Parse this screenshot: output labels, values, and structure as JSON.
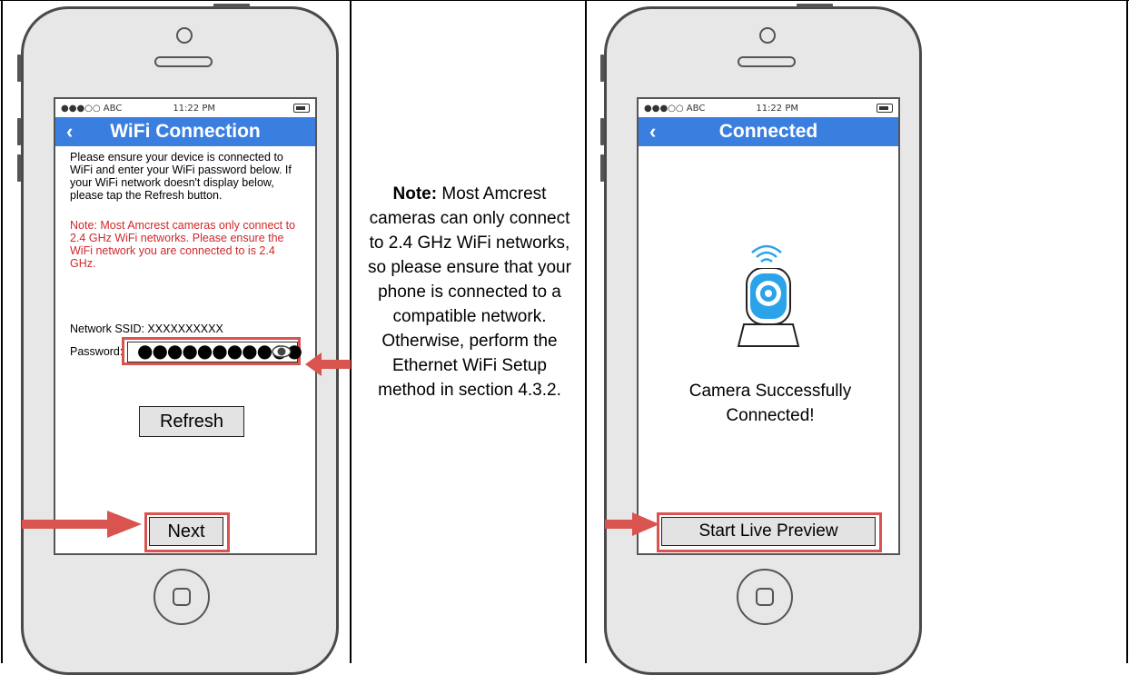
{
  "left_phone": {
    "status": {
      "carrier": "●●●○○ ABC",
      "time": "11:22 PM"
    },
    "nav": {
      "back": "‹",
      "title": "WiFi Connection"
    },
    "instructions": "Please ensure your device is connected to WiFi and enter your WiFi password below. If your WiFi network doesn't display below, please tap the Refresh button.",
    "warning": "Note: Most Amcrest cameras only connect to 2.4 GHz WiFi networks. Please ensure the WiFi network you are connected to is 2.4 GHz.",
    "ssid_label": "Network SSID: XXXXXXXXXX",
    "password_label": "Password:",
    "password_value": "●●●●●●●●●●●",
    "refresh_label": "Refresh",
    "next_label": "Next"
  },
  "note": {
    "bold": "Note:",
    "text": " Most Amcrest cameras can only connect to 2.4 GHz WiFi networks, so please ensure that your phone is connected to a compatible network. Otherwise, perform the Ethernet WiFi Setup method in section 4.3.2."
  },
  "right_phone": {
    "status": {
      "carrier": "●●●○○ ABC",
      "time": "11:22 PM"
    },
    "nav": {
      "back": "‹",
      "title": "Connected"
    },
    "success_text": "Camera Successfully Connected!",
    "preview_label": "Start Live Preview"
  },
  "colors": {
    "nav_blue": "#3a7fe0",
    "highlight_red": "#d9534f",
    "warning_red": "#d0282c",
    "camera_blue": "#2aa3e8"
  },
  "icons": [
    "back-chevron-icon",
    "battery-icon",
    "eye-icon",
    "wifi-icon",
    "camera-icon",
    "arrow-icon"
  ]
}
